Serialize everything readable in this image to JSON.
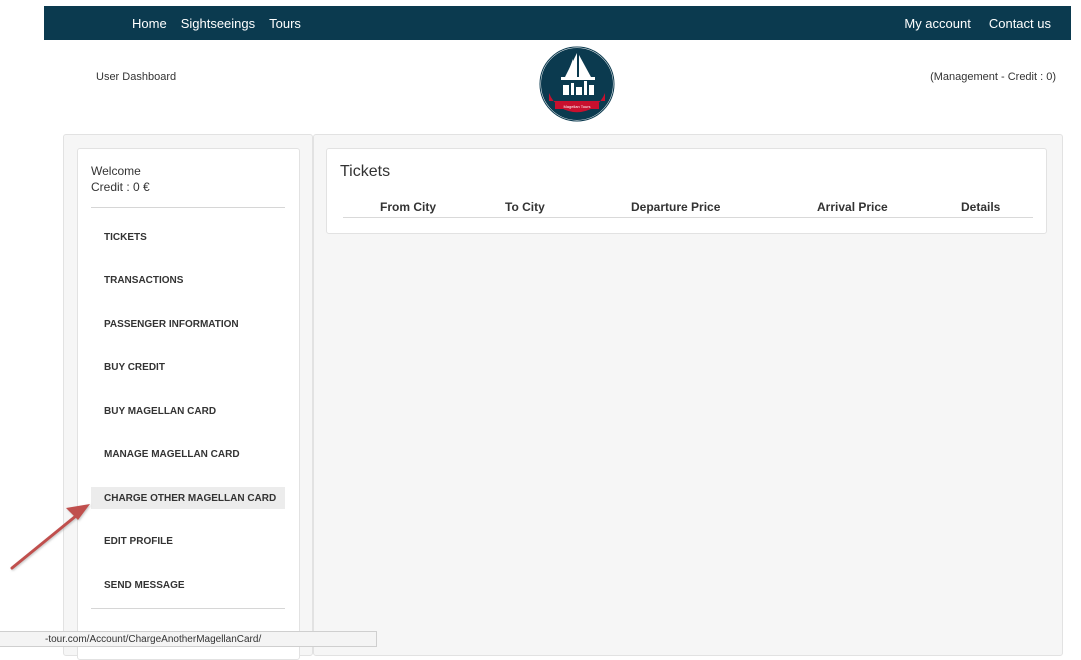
{
  "nav": {
    "left": [
      "Home",
      "Sightseeings",
      "Tours"
    ],
    "right": [
      "My account",
      "Contact us"
    ]
  },
  "header": {
    "user_dashboard": "User Dashboard",
    "management": "(Management - Credit : 0)",
    "logo_brand": "Magellan Tours"
  },
  "sidebar": {
    "welcome": "Welcome",
    "credit": "Credit : 0 €",
    "items": [
      {
        "label": "TICKETS"
      },
      {
        "label": "TRANSACTIONS"
      },
      {
        "label": "PASSENGER INFORMATION"
      },
      {
        "label": "BUY CREDIT"
      },
      {
        "label": "BUY MAGELLAN CARD"
      },
      {
        "label": "MANAGE MAGELLAN CARD"
      },
      {
        "label": "CHARGE OTHER MAGELLAN CARD"
      },
      {
        "label": "EDIT PROFILE"
      },
      {
        "label": "SEND MESSAGE"
      }
    ]
  },
  "main": {
    "tickets_title": "Tickets",
    "columns": [
      "From City",
      "To City",
      "Departure Price",
      "Arrival Price",
      "Details"
    ]
  },
  "status_bar": {
    "url": "-tour.com/Account/ChargeAnotherMagellanCard/"
  },
  "colors": {
    "navbar": "#0b3a4f",
    "logo_red": "#c8102e",
    "annotation_arrow": "#c0504d"
  }
}
